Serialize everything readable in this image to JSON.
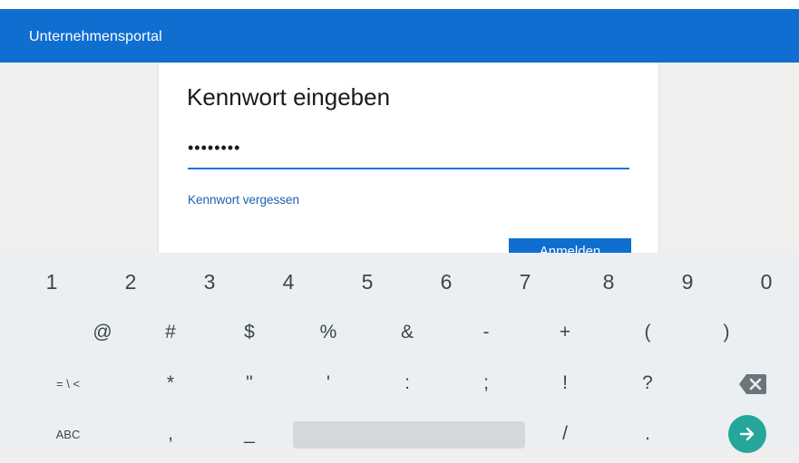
{
  "app": {
    "title": "Unternehmensportal"
  },
  "card": {
    "title": "Kennwort eingeben",
    "password_value": "••••••••",
    "forgot_link": "Kennwort vergessen",
    "submit_label": "Anmelden"
  },
  "keyboard": {
    "row1": [
      "1",
      "2",
      "3",
      "4",
      "5",
      "6",
      "7",
      "8",
      "9",
      "0"
    ],
    "row2": [
      "@",
      "#",
      "$",
      "%",
      "&",
      "-",
      "+",
      "(",
      ")"
    ],
    "row3": [
      "= \\ <",
      "*",
      "\"",
      "'",
      ":",
      ";",
      "!",
      "?"
    ],
    "row4_left": "ABC",
    "row4_keys": [
      ",",
      "_",
      "/",
      "."
    ],
    "backspace_icon": "backspace-icon",
    "enter_icon": "arrow-right-icon"
  },
  "colors": {
    "app_bar": "#0f6fd1",
    "field_underline": "#1f74d4",
    "link": "#1a5fb4",
    "keyboard_bg": "#eceff1",
    "enter_key": "#26a69a"
  }
}
